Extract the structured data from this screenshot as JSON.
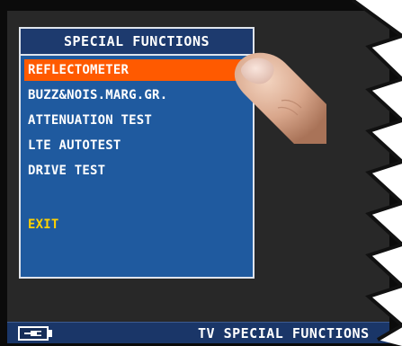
{
  "menu": {
    "title": "SPECIAL FUNCTIONS",
    "items": [
      {
        "label": "REFLECTOMETER",
        "selected": true
      },
      {
        "label": "BUZZ&NOIS.MARG.GR.",
        "selected": false
      },
      {
        "label": "ATTENUATION TEST",
        "selected": false
      },
      {
        "label": "LTE AUTOTEST",
        "selected": false
      },
      {
        "label": "DRIVE TEST",
        "selected": false
      }
    ],
    "exit_label": "EXIT"
  },
  "status_bar": {
    "title": "TV SPECIAL FUNCTIONS",
    "battery_icon": "battery-plug-icon"
  },
  "colors": {
    "screen_bg": "#282828",
    "panel_bg": "#1f5a9f",
    "title_bg": "#1d3a6e",
    "selection": "#ff5a00",
    "exit_text": "#ffd200",
    "status_bg": "#1a3668"
  }
}
